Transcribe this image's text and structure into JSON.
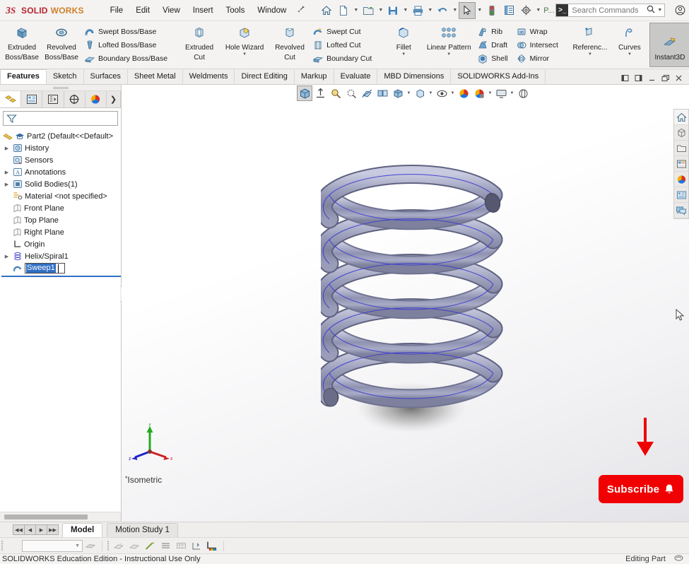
{
  "app": {
    "brand_ds": "3DS",
    "brand_solid": "SOLID",
    "brand_works": "WORKS",
    "accent_red": "#b8242d",
    "accent_orange": "#d07f2a"
  },
  "menubar": {
    "items": [
      "File",
      "Edit",
      "View",
      "Insert",
      "Tools",
      "Window"
    ],
    "pin_icon": "pin-icon"
  },
  "quick_access": {
    "items": [
      {
        "name": "home-icon",
        "label": "Home"
      },
      {
        "name": "new-document-icon",
        "label": "New"
      },
      {
        "name": "open-document-icon",
        "label": "Open"
      },
      {
        "name": "save-icon",
        "label": "Save"
      },
      {
        "name": "print-icon",
        "label": "Print"
      },
      {
        "name": "undo-icon",
        "label": "Undo"
      },
      {
        "name": "select-cursor-icon",
        "label": "Select"
      },
      {
        "name": "rebuild-icon",
        "label": "Rebuild"
      },
      {
        "name": "file-properties-icon",
        "label": "File Properties"
      },
      {
        "name": "options-gear-icon",
        "label": "Options"
      }
    ],
    "overflow_label": "P..."
  },
  "search": {
    "placeholder": "Search Commands",
    "value": ""
  },
  "window_controls": {
    "account": "account-icon",
    "help": "help-icon",
    "minimize": "—",
    "maximize": "☐",
    "close": "✕"
  },
  "ribbon": {
    "groups": [
      {
        "big": [
          {
            "label_line1": "Extruded",
            "label_line2": "Boss/Base",
            "icon": "extruded-boss-icon"
          },
          {
            "label_line1": "Revolved",
            "label_line2": "Boss/Base",
            "icon": "revolved-boss-icon"
          }
        ],
        "small": [
          {
            "label": "Swept Boss/Base",
            "icon": "swept-boss-icon"
          },
          {
            "label": "Lofted Boss/Base",
            "icon": "lofted-boss-icon"
          },
          {
            "label": "Boundary Boss/Base",
            "icon": "boundary-boss-icon"
          }
        ]
      },
      {
        "big": [
          {
            "label_line1": "Extruded",
            "label_line2": "Cut",
            "icon": "extruded-cut-icon"
          },
          {
            "label_line1": "Hole Wizard",
            "label_line2": "",
            "icon": "hole-wizard-icon",
            "caret": true
          },
          {
            "label_line1": "Revolved",
            "label_line2": "Cut",
            "icon": "revolved-cut-icon"
          }
        ],
        "small": [
          {
            "label": "Swept Cut",
            "icon": "swept-cut-icon"
          },
          {
            "label": "Lofted Cut",
            "icon": "lofted-cut-icon"
          },
          {
            "label": "Boundary Cut",
            "icon": "boundary-cut-icon"
          }
        ]
      },
      {
        "big": [
          {
            "label_line1": "Fillet",
            "label_line2": "",
            "icon": "fillet-icon",
            "caret": true
          },
          {
            "label_line1": "Linear Pattern",
            "label_line2": "",
            "icon": "linear-pattern-icon",
            "caret": true
          }
        ],
        "small": [
          {
            "label": "Rib",
            "icon": "rib-icon"
          },
          {
            "label": "Draft",
            "icon": "draft-icon"
          },
          {
            "label": "Shell",
            "icon": "shell-icon"
          }
        ],
        "small2": [
          {
            "label": "Wrap",
            "icon": "wrap-icon"
          },
          {
            "label": "Intersect",
            "icon": "intersect-icon"
          },
          {
            "label": "Mirror",
            "icon": "mirror-icon"
          }
        ]
      },
      {
        "big": [
          {
            "label_line1": "Referenc...",
            "label_line2": "",
            "icon": "reference-geometry-icon",
            "caret": true
          },
          {
            "label_line1": "Curves",
            "label_line2": "",
            "icon": "curves-icon",
            "caret": true
          },
          {
            "label_line1": "Instant3D",
            "label_line2": "",
            "icon": "instant3d-icon",
            "active": true
          }
        ]
      }
    ]
  },
  "command_tabs": {
    "items": [
      "Features",
      "Sketch",
      "Surfaces",
      "Sheet Metal",
      "Weldments",
      "Direct Editing",
      "Markup",
      "Evaluate",
      "MBD Dimensions",
      "SOLIDWORKS Add-Ins"
    ],
    "active": "Features",
    "doc_buttons": [
      "restore-left-icon",
      "restore-right-icon",
      "minimize-icon",
      "restore-icon",
      "close-icon"
    ]
  },
  "feature_manager": {
    "tabs": [
      {
        "name": "feature-manager-tab",
        "icon": "feature-tree-icon",
        "active": true
      },
      {
        "name": "property-manager-tab",
        "icon": "property-manager-icon",
        "active": false
      },
      {
        "name": "configuration-manager-tab",
        "icon": "configuration-icon",
        "active": false
      },
      {
        "name": "dimxpert-manager-tab",
        "icon": "dimxpert-icon",
        "active": false
      },
      {
        "name": "display-manager-tab",
        "icon": "display-manager-icon",
        "active": false
      },
      {
        "name": "more-tabs",
        "icon": "chevron-right-icon",
        "active": false
      }
    ],
    "filter_placeholder": "",
    "root": {
      "label": "Part2  (Default<<Default>",
      "icon": "part-icon"
    },
    "items": [
      {
        "label": "History",
        "icon": "history-icon",
        "expandable": true,
        "indent": 0
      },
      {
        "label": "Sensors",
        "icon": "sensors-icon",
        "expandable": false,
        "indent": 0
      },
      {
        "label": "Annotations",
        "icon": "annotations-icon",
        "expandable": true,
        "indent": 0
      },
      {
        "label": "Solid Bodies(1)",
        "icon": "solid-bodies-icon",
        "expandable": true,
        "indent": 0
      },
      {
        "label": "Material <not specified>",
        "icon": "material-icon",
        "expandable": false,
        "indent": 0
      },
      {
        "label": "Front Plane",
        "icon": "plane-icon",
        "expandable": false,
        "indent": 0
      },
      {
        "label": "Top Plane",
        "icon": "plane-icon",
        "expandable": false,
        "indent": 0
      },
      {
        "label": "Right Plane",
        "icon": "plane-icon",
        "expandable": false,
        "indent": 0
      },
      {
        "label": "Origin",
        "icon": "origin-icon",
        "expandable": false,
        "indent": 0
      },
      {
        "label": "Helix/Spiral1",
        "icon": "helix-icon",
        "expandable": true,
        "indent": 0
      }
    ],
    "editing_item": {
      "label": "Sweep1",
      "icon": "sweep-icon",
      "renaming": true,
      "selection_color": "#2f6fc4"
    }
  },
  "view_toolbar": {
    "items": [
      {
        "name": "zoom-to-fit-icon",
        "active": true
      },
      {
        "name": "zoom-to-area-icon",
        "active": false
      },
      {
        "name": "zoom-in-out-icon",
        "active": false
      },
      {
        "name": "previous-view-icon",
        "active": false
      },
      {
        "name": "section-view-icon",
        "active": false
      },
      {
        "name": "view-orientation-icon",
        "active": false
      },
      {
        "name": "display-style-icon",
        "active": false,
        "caret": true
      },
      {
        "name": "hide-show-items-icon",
        "active": false,
        "caret": true
      },
      {
        "name": "edit-appearance-icon",
        "active": false,
        "caret": true
      },
      {
        "name": "apply-scene-icon",
        "active": false,
        "caret": true
      },
      {
        "name": "view-settings-icon",
        "active": false,
        "caret": true
      },
      {
        "name": "full-screen-icon",
        "active": false
      }
    ]
  },
  "right_dock": {
    "items": [
      {
        "name": "solidworks-resources-icon"
      },
      {
        "name": "design-library-icon"
      },
      {
        "name": "file-explorer-icon"
      },
      {
        "name": "view-palette-icon"
      },
      {
        "name": "appearances-scenes-icon"
      },
      {
        "name": "custom-properties-icon"
      },
      {
        "name": "solidworks-forum-icon"
      }
    ]
  },
  "model": {
    "type": "helical-spring",
    "body_color": "#a6a8c4",
    "edge_color": "#3a3ad0",
    "view_name": "Isometric",
    "view_name_prefix": "*",
    "triad": {
      "x_label": "x",
      "x_color": "#cc2222",
      "y_label": "y",
      "y_color": "#22aa22",
      "z_label": "z",
      "z_color": "#2222cc"
    }
  },
  "overlay": {
    "subscribe_label": "Subscribe",
    "subscribe_bell": "🔔",
    "subscribe_bg": "#f00000",
    "arrow_color": "#ee0000",
    "arrow_name": "red-down-arrow"
  },
  "bottom_tabs": {
    "nav": [
      "◀◀",
      "◀",
      "▶",
      "▶▶"
    ],
    "tabs": [
      "Model",
      "Motion Study 1"
    ],
    "active": "Model"
  },
  "bottom_toolbar": {
    "combo_value": "",
    "buttons": [
      {
        "name": "appearance-icon"
      },
      {
        "name": "edit-appearance-icon"
      },
      {
        "name": "edit-material-icon"
      },
      {
        "name": "edit-color-icon"
      },
      {
        "name": "display-pattern-icon"
      },
      {
        "name": "section-properties-icon"
      },
      {
        "name": "measure-icon"
      },
      {
        "name": "color-palette-icon"
      }
    ]
  },
  "status_bar": {
    "license_text": "SOLIDWORKS Education Edition - Instructional Use Only",
    "editing_text": "Editing Part",
    "right_icon": "sw-status-icon"
  }
}
